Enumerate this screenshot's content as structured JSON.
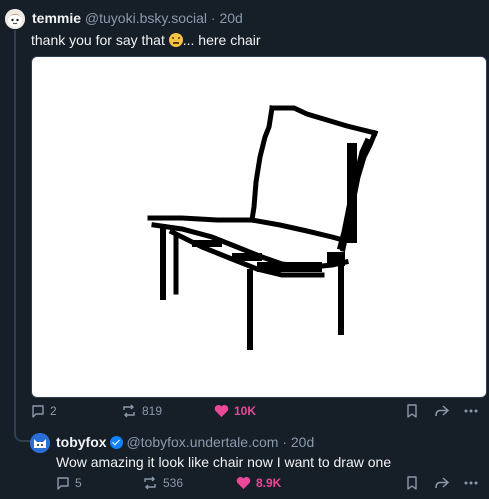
{
  "post1": {
    "display_name": "temmie",
    "handle": "@tuyoki.bsky.social",
    "separator": "·",
    "time": "20d",
    "text_before": "thank you for say that",
    "text_after": "... here chair",
    "emoji": "slightly-smiling-face",
    "image_alt": "pixel drawing of a chair",
    "actions": {
      "replies": "2",
      "reposts": "819",
      "likes": "10K",
      "liked": true
    }
  },
  "post2": {
    "display_name": "tobyfox",
    "verified": true,
    "handle": "@tobyfox.undertale.com",
    "separator": "·",
    "time": "20d",
    "text": "Wow amazing it look like chair now I want to draw one",
    "actions": {
      "replies": "5",
      "reposts": "536",
      "likes": "8.9K",
      "liked": true
    }
  },
  "colors": {
    "background": "#161e27",
    "text": "#f1f3f5",
    "muted": "#8a9aad",
    "like": "#ec4899",
    "verified": "#1083fe",
    "thread_line": "#2e4052"
  }
}
